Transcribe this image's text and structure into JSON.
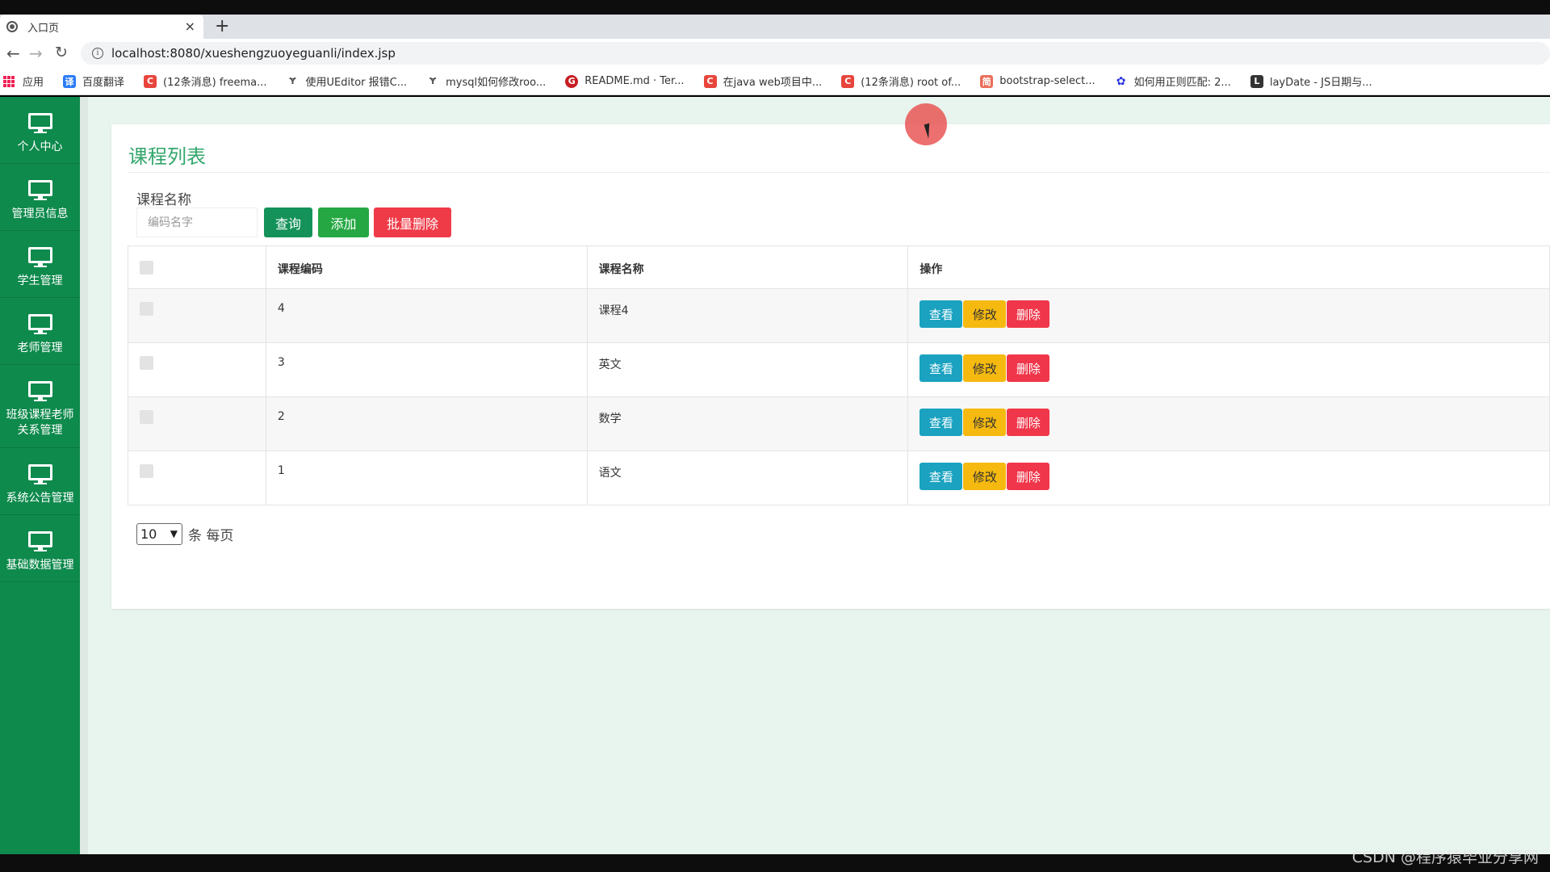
{
  "browser": {
    "tab_title": "入口页",
    "tab_close": "×",
    "new_tab": "+",
    "url": "localhost:8080/xueshengzuoyeguanli/index.jsp",
    "bookmarks": [
      {
        "label": "应用",
        "icon": "apps-grid-icon",
        "color": "#e53935"
      },
      {
        "label": "百度翻译",
        "icon": "baidu-translate-icon",
        "color": "#2b7cf7"
      },
      {
        "label": "(12条消息) freema...",
        "icon": "csdn-icon",
        "color": "#e8453c"
      },
      {
        "label": "使用UEditor 报错C...",
        "icon": "zhihu-icon",
        "color": "#555555"
      },
      {
        "label": "mysql如何修改roo...",
        "icon": "zhihu-icon",
        "color": "#555555"
      },
      {
        "label": "README.md · Ter...",
        "icon": "gitee-icon",
        "color": "#c71d23"
      },
      {
        "label": "在java web项目中...",
        "icon": "csdn-icon",
        "color": "#e8453c"
      },
      {
        "label": "(12条消息) root of...",
        "icon": "csdn-icon",
        "color": "#e8453c"
      },
      {
        "label": "bootstrap-select...",
        "icon": "jianshu-icon",
        "color": "#ea6f5a"
      },
      {
        "label": "如何用正则匹配: 2...",
        "icon": "baidu-paw-icon",
        "color": "#2932e1"
      },
      {
        "label": "layDate - JS日期与...",
        "icon": "laydate-icon",
        "color": "#333333"
      }
    ]
  },
  "sidebar": {
    "items": [
      {
        "label": "个人中心",
        "icon": "monitor-icon"
      },
      {
        "label": "管理员信息",
        "icon": "monitor-icon"
      },
      {
        "label": "学生管理",
        "icon": "monitor-icon"
      },
      {
        "label": "老师管理",
        "icon": "monitor-icon"
      },
      {
        "label": "班级课程老师\n关系管理",
        "icon": "monitor-icon"
      },
      {
        "label": "系统公告管理",
        "icon": "monitor-icon"
      },
      {
        "label": "基础数据管理",
        "icon": "monitor-icon"
      }
    ]
  },
  "main": {
    "title": "课程列表",
    "search_label": "课程名称",
    "search_placeholder": "编码名字",
    "query_button": "查询",
    "add_button": "添加",
    "batch_delete_button": "批量删除",
    "table": {
      "headers": [
        "",
        "课程编码",
        "课程名称",
        "操作"
      ],
      "rows": [
        {
          "code": "4",
          "name": "课程4"
        },
        {
          "code": "3",
          "name": "英文"
        },
        {
          "code": "2",
          "name": "数学"
        },
        {
          "code": "1",
          "name": "语文"
        }
      ],
      "action_view": "查看",
      "action_edit": "修改",
      "action_delete": "删除"
    },
    "pager": {
      "page_size": "10",
      "suffix": "条 每页"
    }
  },
  "watermark": "CSDN @程序猿毕业分享网",
  "colors": {
    "sidebar": "#0e8a4c",
    "title": "#32a66b",
    "query": "#15925a",
    "add": "#25a843",
    "danger": "#ef3b48",
    "view": "#1aa2c0",
    "edit": "#f5b90f"
  }
}
